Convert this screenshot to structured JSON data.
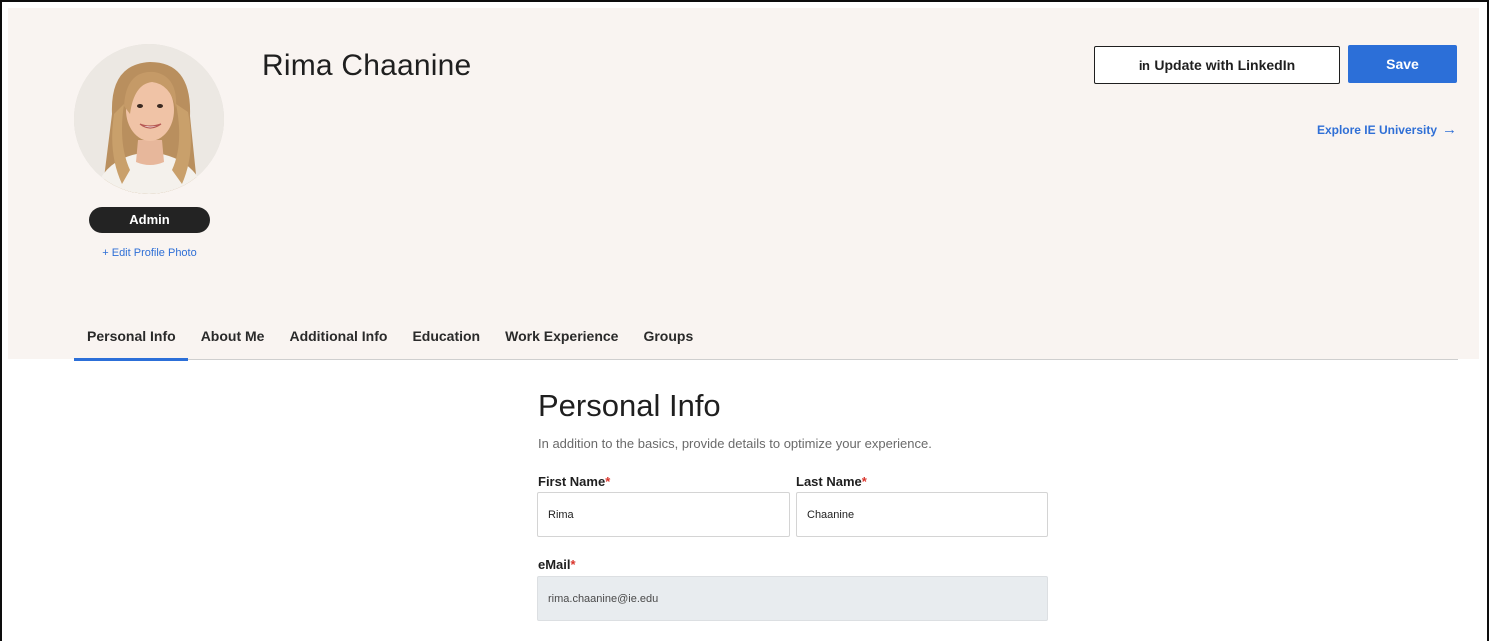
{
  "profile": {
    "name": "Rima Chaanine",
    "role_badge": "Admin",
    "edit_photo_label": "+ Edit Profile Photo"
  },
  "actions": {
    "linkedin_icon": "in",
    "linkedin_label": "Update with LinkedIn",
    "save_label": "Save",
    "explore_label": "Explore IE University",
    "explore_icon": "→"
  },
  "tabs": [
    {
      "label": "Personal Info",
      "active": true
    },
    {
      "label": "About Me",
      "active": false
    },
    {
      "label": "Additional Info",
      "active": false
    },
    {
      "label": "Education",
      "active": false
    },
    {
      "label": "Work Experience",
      "active": false
    },
    {
      "label": "Groups",
      "active": false
    }
  ],
  "form": {
    "title": "Personal Info",
    "description": "In addition to the basics, provide details to optimize your experience.",
    "required_mark": "*",
    "first_name": {
      "label": "First Name",
      "value": "Rima"
    },
    "last_name": {
      "label": "Last Name",
      "value": "Chaanine"
    },
    "email": {
      "label": "eMail",
      "value": "rima.chaanine@ie.edu"
    }
  },
  "colors": {
    "accent": "#2c6fd8",
    "header_background": "#f9f4f1",
    "required": "#d9342b",
    "readonly_field": "#e8ecef"
  },
  "icons": {
    "linkedin": "linkedin-icon",
    "explore": "arrow-right-icon"
  }
}
